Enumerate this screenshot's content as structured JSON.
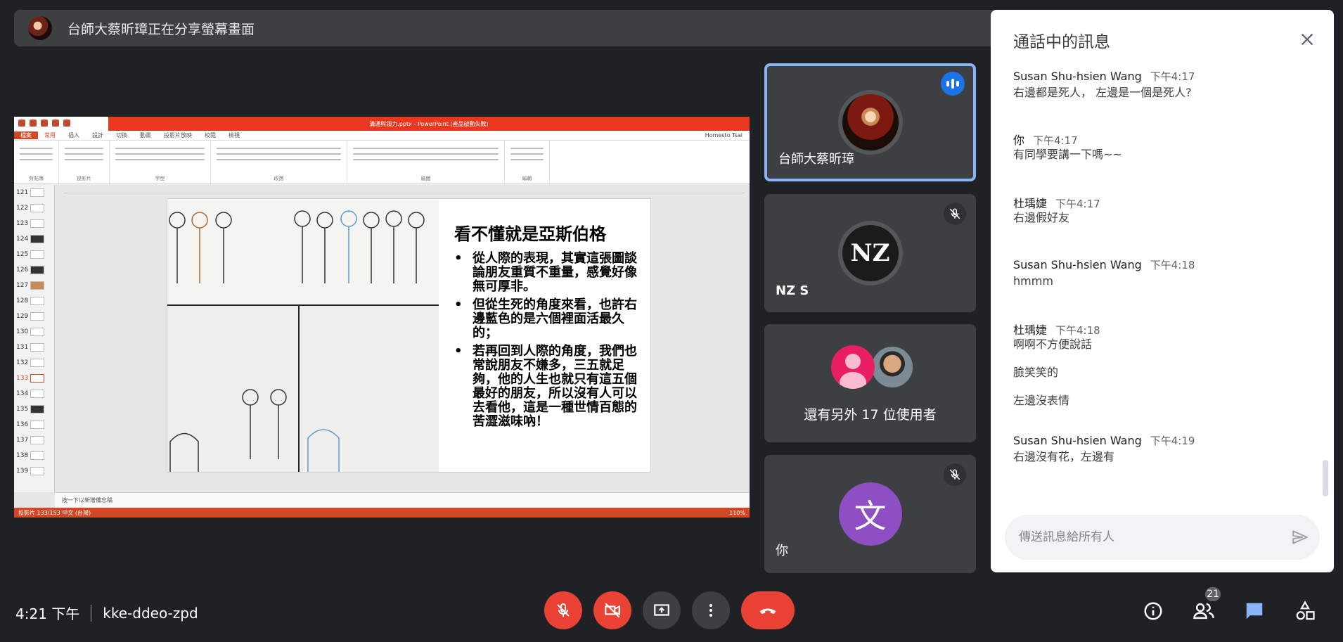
{
  "presenter_bar": {
    "text": "台師大蔡昕璋正在分享螢幕畫面"
  },
  "shared_screen": {
    "ppt_title": "溝通與領力.pptx - PowerPoint (產品啟動失敗)",
    "ppt_tabs": [
      "檔案",
      "常用",
      "插入",
      "設計",
      "切換",
      "動畫",
      "投影片放映",
      "校閱",
      "檢視"
    ],
    "ppt_user": "Homesto Tsai",
    "ribbon_groups": [
      "剪貼簿",
      "投影片",
      "字型",
      "段落",
      "繪圖",
      "編輯"
    ],
    "thumb_numbers": [
      "121",
      "122",
      "123",
      "124",
      "125",
      "126",
      "127",
      "128",
      "129",
      "130",
      "131",
      "132",
      "133",
      "134",
      "135",
      "136",
      "137",
      "138",
      "139"
    ],
    "active_slide": "133",
    "notes_text": "按一下以新增備忘稿",
    "status_left": "投影片 133/153    中文 (台灣)",
    "status_right": "110%",
    "slide": {
      "title": "看不懂就是亞斯伯格",
      "bullets": [
        "從人際的表現，其實這張圖談論朋友重質不重量，感覺好像無可厚非。",
        "但從生死的角度來看，也許右邊藍色的是六個裡面活最久的；",
        "若再回到人際的角度，我們也常說朋友不嫌多，三五就足夠，他的人生也就只有這五個最好的朋友，所以沒有人可以去看他，這是一種世情百態的苦澀滋味吶！"
      ]
    }
  },
  "tiles": {
    "presenter": {
      "name": "台師大蔡昕璋"
    },
    "nzs": {
      "name": "NZ S",
      "avatar_text": "NZ"
    },
    "others": {
      "text": "還有另外 17 位使用者"
    },
    "you": {
      "name": "你",
      "avatar_letter": "文"
    }
  },
  "chat": {
    "title": "通話中的訊息",
    "messages": [
      {
        "sender": "Susan Shu-hsien Wang",
        "time": "下午4:17",
        "lines": [
          "右邊都是死人， 左邊是一個是死人?"
        ]
      },
      {
        "sender": "你",
        "time": "下午4:17",
        "lines": [
          "有同學要講一下嗎~~"
        ]
      },
      {
        "sender": "杜瑀婕",
        "time": "下午4:17",
        "lines": [
          "右邊假好友"
        ]
      },
      {
        "sender": "Susan Shu-hsien Wang",
        "time": "下午4:18",
        "lines": [
          "hmmm"
        ]
      },
      {
        "sender": "杜瑀婕",
        "time": "下午4:18",
        "lines": [
          "啊啊不方便說話",
          "臉笑笑的",
          "左邊沒表情"
        ]
      },
      {
        "sender": "Susan Shu-hsien Wang",
        "time": "下午4:19",
        "lines": [
          "右邊沒有花，左邊有"
        ]
      }
    ],
    "input_placeholder": "傳送訊息給所有人"
  },
  "bottom": {
    "time": "4:21 下午",
    "meeting_code": "kke-ddeo-zpd",
    "participant_count": "21"
  },
  "colors": {
    "danger": "#ea4335",
    "accent": "#8ab4f8",
    "chat_active": "#8ab4f8"
  }
}
